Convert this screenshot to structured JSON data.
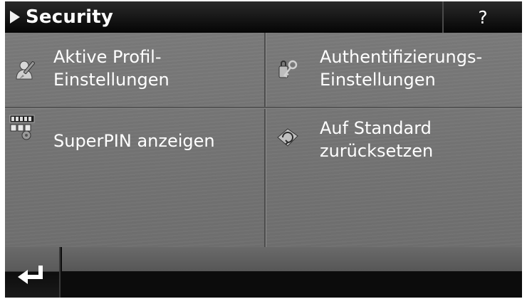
{
  "header": {
    "title": "Security",
    "help_label": "?"
  },
  "menu": {
    "items": [
      {
        "lines": [
          "Aktive Profil-",
          "Einstellungen"
        ],
        "icon": "profile-settings-icon"
      },
      {
        "lines": [
          "Authentifizierungs-",
          "Einstellungen"
        ],
        "icon": "authentication-key-icon"
      },
      {
        "lines": [
          "SuperPIN anzeigen"
        ],
        "icon": "superpin-icon"
      },
      {
        "lines": [
          "Auf Standard",
          "zurücksetzen"
        ],
        "icon": "reset-default-icon"
      }
    ]
  },
  "footer": {
    "back_icon": "return-arrow-icon"
  },
  "colors": {
    "title_bar": "#0a0a0a",
    "menu_background": "#757575",
    "text": "#ffffff"
  }
}
